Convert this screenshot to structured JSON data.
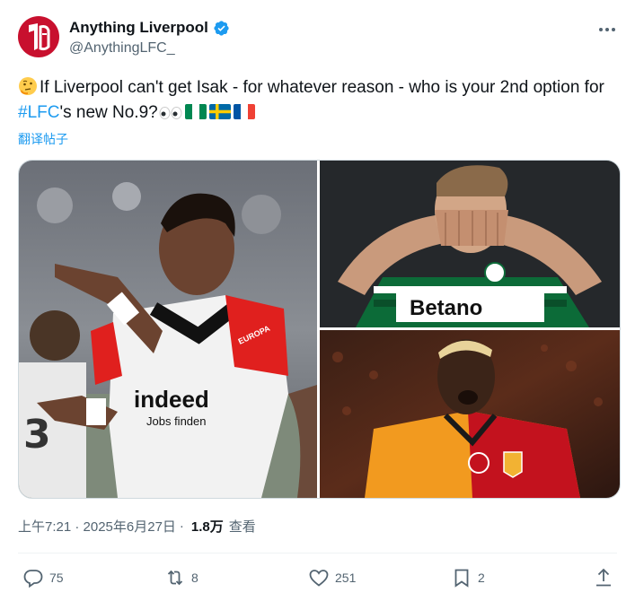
{
  "author": {
    "display_name": "Anything Liverpool",
    "handle": "@AnythingLFC_",
    "avatar_glyph": "LFC",
    "verified": true
  },
  "tweet": {
    "text_before_hashtag": "If Liverpool can't get Isak - for whatever reason - who is your 2nd option for ",
    "hashtag": "#LFC",
    "text_after_hashtag": "'s new No.9?",
    "emojis": [
      "thinking-face",
      "eyes",
      "flag-nigeria",
      "flag-sweden",
      "flag-france"
    ],
    "translate_label": "翻译帖子"
  },
  "media": {
    "photos": [
      {
        "name": "photo-eintracht-player",
        "kit_text": "indeed",
        "kit_subtext": "Jobs finden",
        "sleeve_text": "EUROPA"
      },
      {
        "name": "photo-sporting-player",
        "kit_text": "Betano"
      },
      {
        "name": "photo-galatasaray-player"
      }
    ]
  },
  "meta": {
    "time": "上午7:21 · 2025年6月27日",
    "views": "1.8万",
    "views_label": "查看"
  },
  "actions": {
    "reply_count": "75",
    "retweet_count": "8",
    "like_count": "251",
    "bookmark_count": "2"
  },
  "colors": {
    "accent": "#1d9bf0",
    "text": "#0f1419",
    "secondary": "#536471",
    "brand": "#c8102e"
  }
}
